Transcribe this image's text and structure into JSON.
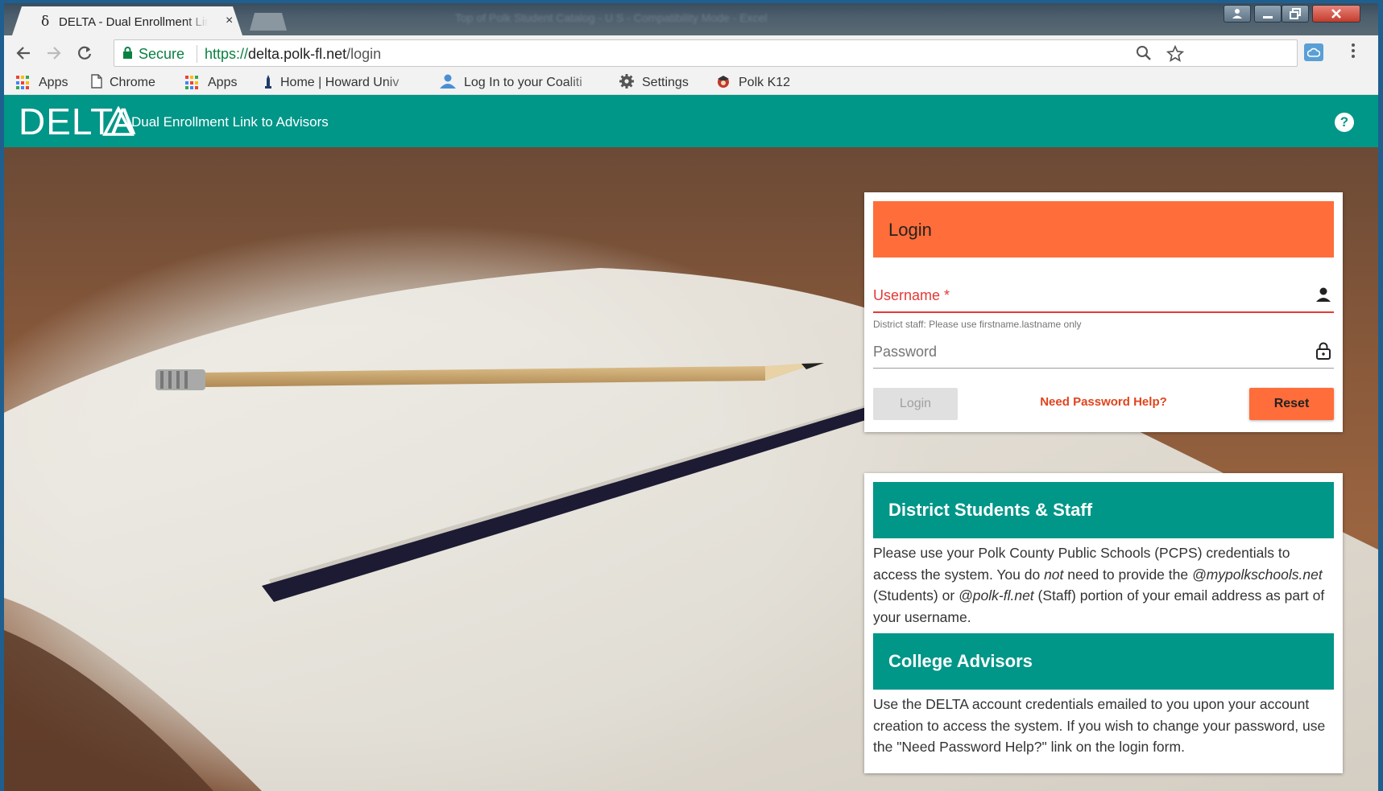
{
  "browser": {
    "tab": {
      "favicon": "δ",
      "title": "DELTA - Dual Enrollment Link to Advisors",
      "close_icon": "×"
    },
    "blurred_title_text": "Top of Polk Student Catalog - U S - Compatibility Mode - Excel",
    "omnibox": {
      "secure_label": "Secure",
      "url_scheme": "https://",
      "url_host": "delta.polk-fl.net",
      "url_path": "/login"
    },
    "bookmarks": [
      {
        "label": "Apps",
        "icon": "apps-grid-icon"
      },
      {
        "label": "Chrome",
        "icon": "page-icon"
      },
      {
        "label": "Apps",
        "icon": "apps-grid-icon"
      },
      {
        "label": "Home | Howard Univ",
        "icon": "howard-icon"
      },
      {
        "label": "Log In to your Coaliti",
        "icon": "person-icon"
      },
      {
        "label": "Settings",
        "icon": "gear-icon"
      },
      {
        "label": "Polk K12",
        "icon": "polk-icon"
      }
    ]
  },
  "app": {
    "logo": "DELTA",
    "tagline": "Dual Enrollment Link to Advisors",
    "help_icon": "?",
    "colors": {
      "primary": "#009688",
      "accent": "#ff6d3a",
      "error": "#e53935"
    }
  },
  "login": {
    "title": "Login",
    "username_label": "Username *",
    "username_hint": "District staff: Please use firstname.lastname only",
    "password_label": "Password",
    "login_button": "Login",
    "help_link": "Need Password Help?",
    "reset_button": "Reset"
  },
  "info": {
    "district_title": "District Students & Staff",
    "district_text_1": "Please use your Polk County Public Schools (PCPS) credentials to access the system. You do ",
    "district_text_not": "not",
    "district_text_2": " need to provide the ",
    "district_text_students_domain": "@mypolkschools.net",
    "district_text_3": " (Students) or ",
    "district_text_staff_domain": "@polk-fl.net",
    "district_text_4": " (Staff) portion of your email address as part of your username.",
    "college_title": "College Advisors",
    "college_text": "Use the DELTA account credentials emailed to you upon your account creation to access the system. If you wish to change your password, use the \"Need Password Help?\" link on the login form."
  }
}
